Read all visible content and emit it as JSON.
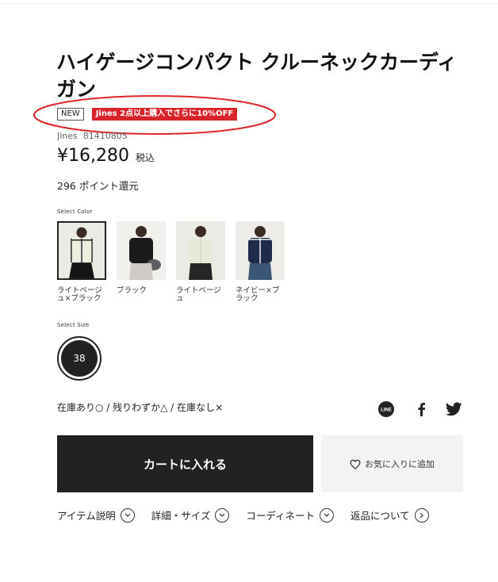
{
  "product": {
    "title": "ハイゲージコンパクト クルーネックカーディガン",
    "badge_new": "NEW",
    "promo_badge": "Jines 2点以上購入でさらに10%OFF",
    "brand": "Jines",
    "code": "81410805",
    "price": "¥16,280",
    "tax_label": "税込",
    "points": "296 ポイント還元"
  },
  "color_select": {
    "label": "Select Color",
    "options": [
      {
        "label": "ライトベージュ×ブラック",
        "selected": true
      },
      {
        "label": "ブラック",
        "selected": false
      },
      {
        "label": "ライトベージュ",
        "selected": false
      },
      {
        "label": "ネイビー×ブラック",
        "selected": false
      }
    ]
  },
  "size_select": {
    "label": "Select Size",
    "options": [
      {
        "label": "38",
        "selected": true
      }
    ]
  },
  "stock_legend": "在庫あり○ / 残りわずか△ / 在庫なし×",
  "social": {
    "line_icon": "line-icon",
    "line_text": "LINE",
    "facebook_icon": "facebook-icon",
    "twitter_icon": "twitter-icon"
  },
  "actions": {
    "add_to_cart": "カートに入れる",
    "add_to_favorites": "お気に入りに追加"
  },
  "detail_links": [
    {
      "label": "アイテム説明",
      "icon": "chevron-down-icon"
    },
    {
      "label": "詳細・サイズ",
      "icon": "chevron-down-icon"
    },
    {
      "label": "コーディネート",
      "icon": "chevron-down-icon"
    },
    {
      "label": "返品について",
      "icon": "chevron-right-icon"
    }
  ],
  "colors": {
    "promo_red": "#d8232a",
    "annotation_red": "#e0262b",
    "cart_button": "#222222",
    "favorite_button": "#f4f2f2"
  }
}
